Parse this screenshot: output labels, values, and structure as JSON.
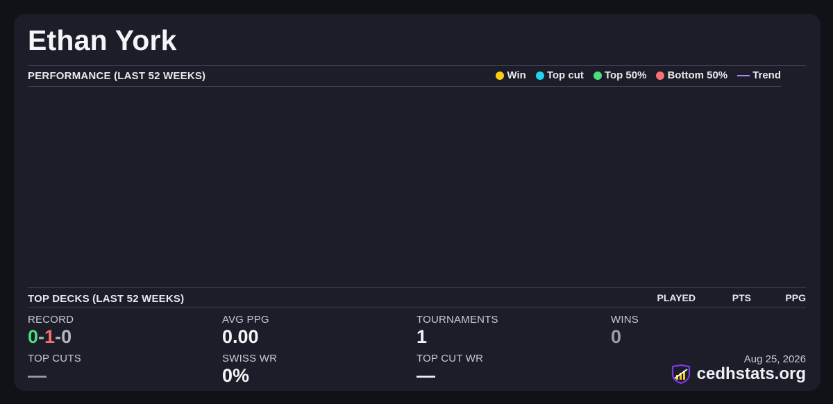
{
  "player": {
    "name": "Ethan York"
  },
  "performance": {
    "title": "PERFORMANCE (LAST 52 WEEKS)",
    "legend": [
      {
        "label": "Win",
        "color": "#facc15",
        "shape": "dot"
      },
      {
        "label": "Top cut",
        "color": "#22d3ee",
        "shape": "dot"
      },
      {
        "label": "Top 50%",
        "color": "#4ade80",
        "shape": "dot"
      },
      {
        "label": "Bottom 50%",
        "color": "#f87171",
        "shape": "dot"
      },
      {
        "label": "Trend",
        "color": "#a78bfa",
        "shape": "line"
      }
    ]
  },
  "top_decks": {
    "title": "TOP DECKS (LAST 52 WEEKS)",
    "columns": [
      "PLAYED",
      "PTS",
      "PPG"
    ]
  },
  "stats": {
    "record": {
      "label": "RECORD",
      "wins": "0",
      "losses": "1",
      "draws": "0",
      "sep": "-"
    },
    "avg_ppg": {
      "label": "AVG PPG",
      "value": "0.00"
    },
    "tournaments": {
      "label": "TOURNAMENTS",
      "value": "1"
    },
    "wins": {
      "label": "WINS",
      "value": "0"
    },
    "top_cuts": {
      "label": "TOP CUTS",
      "value": "—"
    },
    "swiss_wr": {
      "label": "SWISS WR",
      "value": "0%"
    },
    "top_cut_wr": {
      "label": "TOP CUT WR",
      "value": "—"
    }
  },
  "footer": {
    "date": "Aug 25, 2026",
    "brand": "cedhstats.org",
    "brand_icon": "chart-shield-icon"
  }
}
